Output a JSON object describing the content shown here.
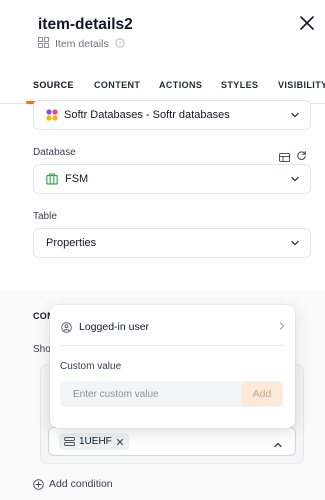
{
  "header": {
    "title": "item-details2",
    "subtitle": "Item details"
  },
  "tabs": [
    {
      "label": "SOURCE",
      "active": true
    },
    {
      "label": "CONTENT",
      "active": false
    },
    {
      "label": "ACTIONS",
      "active": false
    },
    {
      "label": "STYLES",
      "active": false
    },
    {
      "label": "VISIBILITY",
      "active": false
    }
  ],
  "source": {
    "connection_value": "Softr Databases - Softr databases",
    "database_label": "Database",
    "database_value": "FSM",
    "table_label": "Table",
    "table_value": "Properties"
  },
  "conditions": {
    "section_title_visible": "CON",
    "show_label_visible": "Sho",
    "tag_value": "1UEHF",
    "add_condition_label": "Add condition"
  },
  "popover": {
    "user_option": "Logged-in user",
    "custom_value_label": "Custom value",
    "custom_value_placeholder": "Enter custom value",
    "add_button": "Add"
  },
  "colors": {
    "accent": "#ff6b1a",
    "database_icon": "#34a853",
    "add_button_bg": "#fde9d8"
  }
}
